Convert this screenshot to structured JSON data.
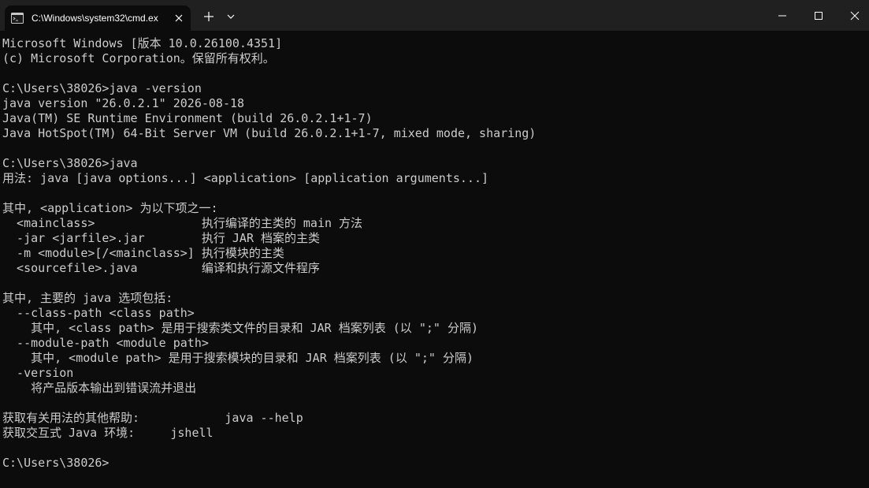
{
  "window": {
    "tab_title": "C:\\Windows\\system32\\cmd.ex",
    "tab_icon": "terminal-icon",
    "new_tab_icon": "plus-icon",
    "dropdown_icon": "chevron-down-icon",
    "minimize_icon": "minimize-icon",
    "maximize_icon": "maximize-icon",
    "close_icon": "close-icon"
  },
  "colors": {
    "background": "#0c0c0c",
    "titlebar": "#202020",
    "text": "#cccccc"
  },
  "console": {
    "lines": [
      "Microsoft Windows [版本 10.0.26100.4351]",
      "(c) Microsoft Corporation。保留所有权利。",
      "",
      "C:\\Users\\38026>java -version",
      "java version \"26.0.2.1\" 2026-08-18",
      "Java(TM) SE Runtime Environment (build 26.0.2.1+1-7)",
      "Java HotSpot(TM) 64-Bit Server VM (build 26.0.2.1+1-7, mixed mode, sharing)",
      "",
      "C:\\Users\\38026>java",
      "用法: java [java options...] <application> [application arguments...]",
      "",
      "其中, <application> 为以下项之一:",
      "  <mainclass>               执行编译的主类的 main 方法",
      "  -jar <jarfile>.jar        执行 JAR 档案的主类",
      "  -m <module>[/<mainclass>] 执行模块的主类",
      "  <sourcefile>.java         编译和执行源文件程序",
      "",
      "其中, 主要的 java 选项包括:",
      "  --class-path <class path>",
      "    其中, <class path> 是用于搜索类文件的目录和 JAR 档案列表 (以 \";\" 分隔)",
      "  --module-path <module path>",
      "    其中, <module path> 是用于搜索模块的目录和 JAR 档案列表 (以 \";\" 分隔)",
      "  -version",
      "    将产品版本输出到错误流并退出",
      "",
      "获取有关用法的其他帮助:            java --help",
      "获取交互式 Java 环境:     jshell",
      "",
      "C:\\Users\\38026>"
    ]
  }
}
